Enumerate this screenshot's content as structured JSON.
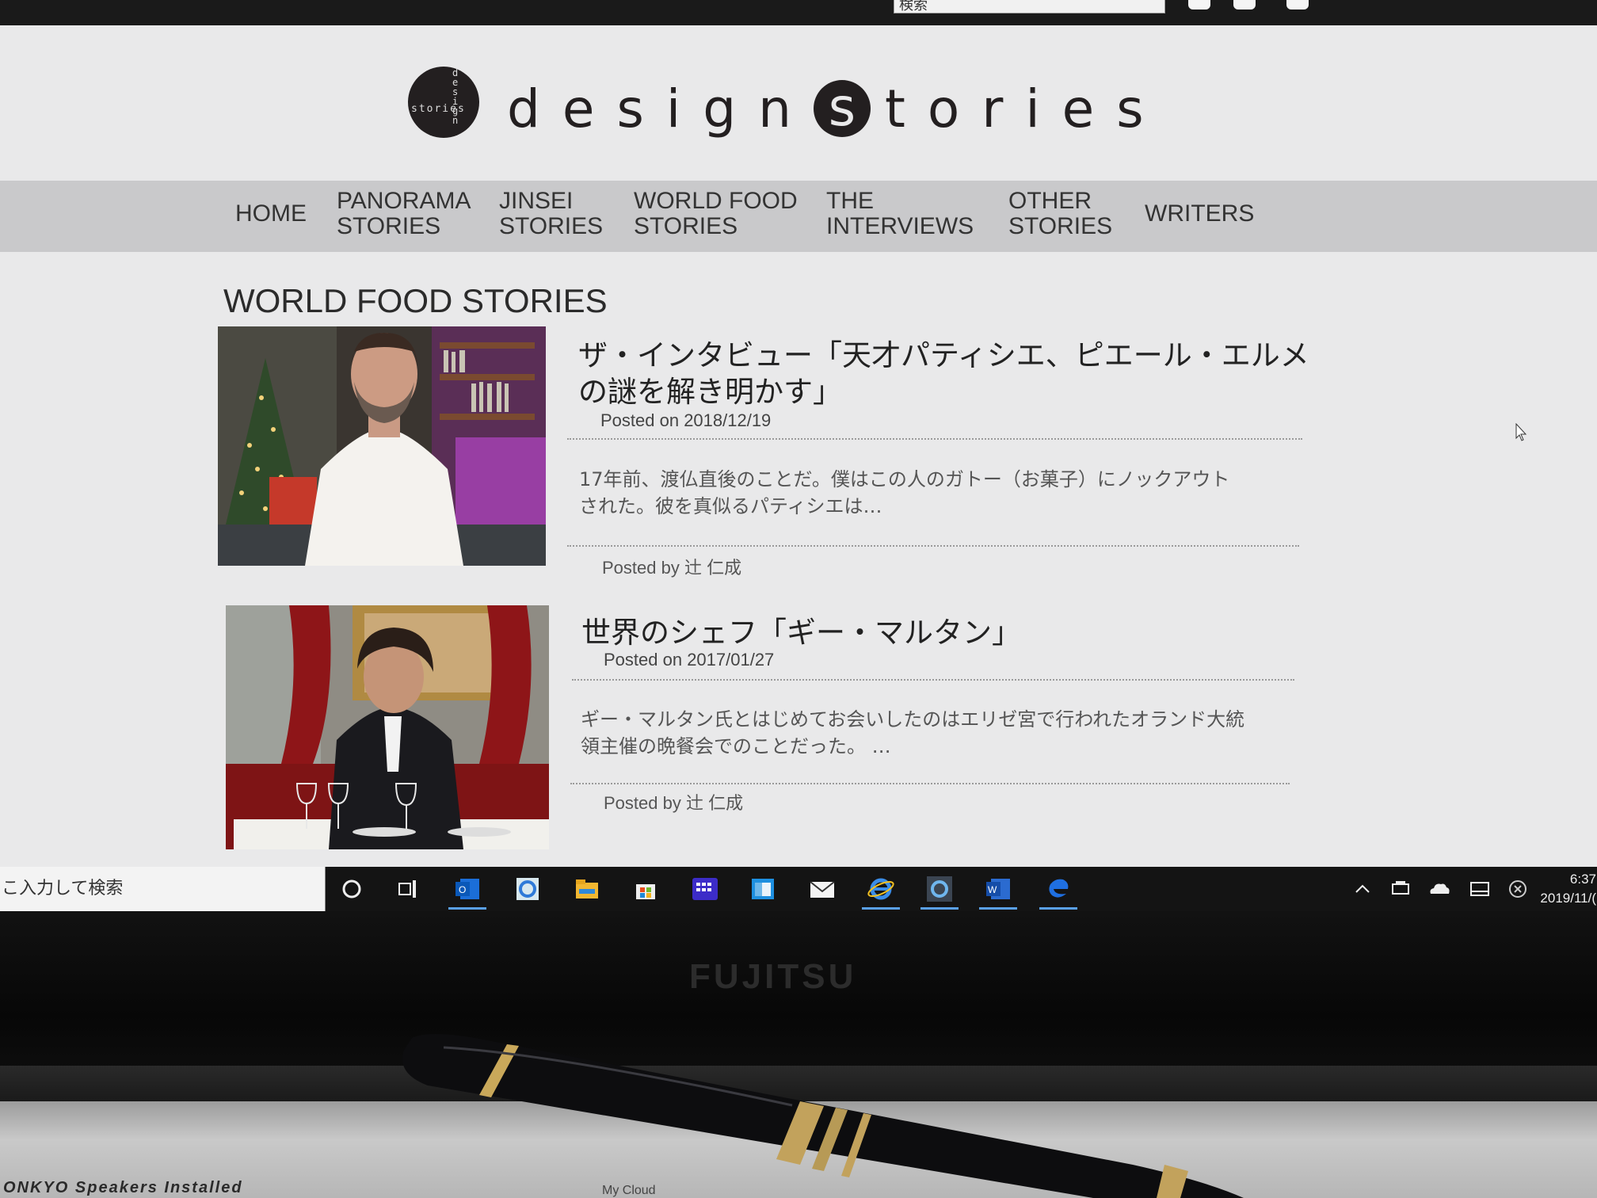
{
  "browser": {
    "search_placeholder": "検索"
  },
  "site": {
    "logo_mark_horizontal": "stories",
    "logo_mark_vertical": "design",
    "logo_text_before": "design",
    "logo_text_circled": "s",
    "logo_text_after": "tories"
  },
  "nav": {
    "items": [
      {
        "line1": "HOME",
        "line2": ""
      },
      {
        "line1": "PANORAMA",
        "line2": "STORIES"
      },
      {
        "line1": "JINSEI",
        "line2": "STORIES"
      },
      {
        "line1": "WORLD FOOD",
        "line2": "STORIES"
      },
      {
        "line1": "THE",
        "line2": "INTERVIEWS"
      },
      {
        "line1": "OTHER",
        "line2": "STORIES"
      },
      {
        "line1": "WRITERS",
        "line2": ""
      }
    ]
  },
  "page": {
    "title": "WORLD FOOD STORIES"
  },
  "posts": [
    {
      "title_line1": "ザ・インタビュー「天才パティシエ、ピエール・エルメ",
      "title_line2": "の謎を解き明かす」",
      "date": "Posted on 2018/12/19",
      "excerpt_line1": "17年前、渡仏直後のことだ。僕はこの人のガトー（お菓子）にノックアウト",
      "excerpt_line2": "された。彼を真似るパティシエは…",
      "author": "Posted by 辻 仁成"
    },
    {
      "title_line1": "世界のシェフ「ギー・マルタン」",
      "title_line2": "",
      "date": "Posted on 2017/01/27",
      "excerpt_line1": "ギー・マルタン氏とはじめてお会いしたのはエリゼ宮で行われたオランド大統",
      "excerpt_line2": "領主催の晩餐会でのことだった。 …",
      "author": "Posted by 辻 仁成"
    }
  ],
  "taskbar": {
    "search_text": "こ入力して検索",
    "time": "6:37",
    "date": "2019/11/("
  },
  "hardware": {
    "brand": "FUJITSU",
    "deck_label": "ONKYO Speakers Installed",
    "deck_label2": "My Cloud"
  },
  "colors": {
    "screen_bg": "#e9e9ea",
    "nav_bg": "#c9c9cb",
    "logo": "#231f20",
    "taskbar": "#141414",
    "taskbar_accent": "#5aa0e8"
  },
  "icons": {
    "social": [
      "facebook-icon",
      "twitter-icon",
      "instagram-icon"
    ],
    "taskbar": [
      "cortana-icon",
      "task-view-icon",
      "outlook-icon",
      "ie-icon",
      "file-explorer-icon",
      "store-icon",
      "app-grid-icon",
      "window-app-icon",
      "mail-icon",
      "ie-icon",
      "ie-icon",
      "word-icon",
      "edge-icon"
    ],
    "tray": [
      "chevron-up-icon",
      "network-icon",
      "onedrive-icon",
      "tablet-icon",
      "close-circle-icon"
    ]
  }
}
